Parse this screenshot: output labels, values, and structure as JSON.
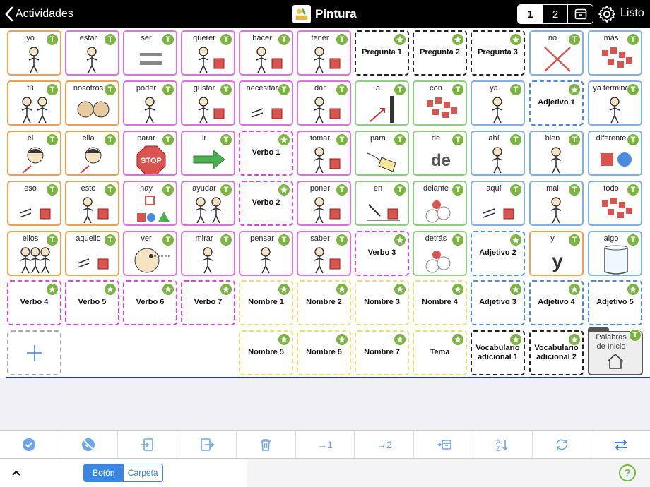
{
  "topbar": {
    "back_label": "Actividades",
    "title": "Pintura",
    "page_segments": [
      "1",
      "2"
    ],
    "done_label": "Listo"
  },
  "grid": [
    [
      {
        "t": "b",
        "label": "yo",
        "c": "orange",
        "pic": "person"
      },
      {
        "t": "b",
        "label": "estar",
        "c": "pink",
        "pic": "person"
      },
      {
        "t": "b",
        "label": "ser",
        "c": "pink",
        "pic": "equals"
      },
      {
        "t": "b",
        "label": "querer",
        "c": "pink",
        "pic": "person-square"
      },
      {
        "t": "b",
        "label": "hacer",
        "c": "pink",
        "pic": "person-square"
      },
      {
        "t": "b",
        "label": "tener",
        "c": "pink",
        "pic": "person-square"
      },
      {
        "t": "f",
        "label": "Pregunta 1",
        "c": "black"
      },
      {
        "t": "f",
        "label": "Pregunta 2",
        "c": "black"
      },
      {
        "t": "f",
        "label": "Pregunta 3",
        "c": "black"
      },
      {
        "t": "b",
        "label": "no",
        "c": "blue",
        "pic": "cross"
      },
      {
        "t": "b",
        "label": "más",
        "c": "blue",
        "pic": "squares"
      }
    ],
    [
      {
        "t": "b",
        "label": "tú",
        "c": "orange",
        "pic": "two-person"
      },
      {
        "t": "b",
        "label": "nosotros",
        "c": "orange",
        "pic": "faces"
      },
      {
        "t": "b",
        "label": "poder",
        "c": "pink",
        "pic": "person"
      },
      {
        "t": "b",
        "label": "gustar",
        "c": "pink",
        "pic": "person-square"
      },
      {
        "t": "b",
        "label": "necesitar",
        "c": "pink",
        "pic": "hand-square"
      },
      {
        "t": "b",
        "label": "dar",
        "c": "pink",
        "pic": "person-square"
      },
      {
        "t": "b",
        "label": "a",
        "c": "green",
        "pic": "arrow-bar"
      },
      {
        "t": "b",
        "label": "con",
        "c": "green",
        "pic": "squares"
      },
      {
        "t": "b",
        "label": "ya",
        "c": "blue",
        "pic": "person"
      },
      {
        "t": "f",
        "label": "Adjetivo 1",
        "c": "blue"
      },
      {
        "t": "b",
        "label": "ya terminó",
        "c": "blue",
        "pic": "person"
      }
    ],
    [
      {
        "t": "b",
        "label": "él",
        "c": "orange",
        "pic": "face"
      },
      {
        "t": "b",
        "label": "ella",
        "c": "orange",
        "pic": "face"
      },
      {
        "t": "b",
        "label": "parar",
        "c": "pink",
        "pic": "stop"
      },
      {
        "t": "b",
        "label": "ir",
        "c": "pink",
        "pic": "arrow-right"
      },
      {
        "t": "f",
        "label": "Verbo 1",
        "c": "pink"
      },
      {
        "t": "b",
        "label": "tomar",
        "c": "pink",
        "pic": "person-square"
      },
      {
        "t": "b",
        "label": "para",
        "c": "green",
        "pic": "tag"
      },
      {
        "t": "b",
        "label": "de",
        "c": "green",
        "pic": "big-de"
      },
      {
        "t": "b",
        "label": "ahí",
        "c": "blue",
        "pic": "person"
      },
      {
        "t": "b",
        "label": "bien",
        "c": "blue",
        "pic": "person"
      },
      {
        "t": "b",
        "label": "diferente",
        "c": "blue",
        "pic": "square-circle"
      }
    ],
    [
      {
        "t": "b",
        "label": "eso",
        "c": "orange",
        "pic": "hand-square"
      },
      {
        "t": "b",
        "label": "esto",
        "c": "orange",
        "pic": "person-square"
      },
      {
        "t": "b",
        "label": "hay",
        "c": "pink",
        "pic": "shapes"
      },
      {
        "t": "b",
        "label": "ayudar",
        "c": "pink",
        "pic": "two-person"
      },
      {
        "t": "f",
        "label": "Verbo 2",
        "c": "pink"
      },
      {
        "t": "b",
        "label": "poner",
        "c": "pink",
        "pic": "person-square"
      },
      {
        "t": "b",
        "label": "en",
        "c": "green",
        "pic": "arrow-square"
      },
      {
        "t": "b",
        "label": "delante",
        "c": "green",
        "pic": "balls"
      },
      {
        "t": "b",
        "label": "aquí",
        "c": "blue",
        "pic": "hand-square"
      },
      {
        "t": "b",
        "label": "mal",
        "c": "blue",
        "pic": "person"
      },
      {
        "t": "b",
        "label": "todo",
        "c": "blue",
        "pic": "squares"
      }
    ],
    [
      {
        "t": "b",
        "label": "ellos",
        "c": "orange",
        "pic": "group"
      },
      {
        "t": "b",
        "label": "aquello",
        "c": "orange",
        "pic": "hand-square"
      },
      {
        "t": "b",
        "label": "ver",
        "c": "pink",
        "pic": "eye-face"
      },
      {
        "t": "b",
        "label": "mirar",
        "c": "pink",
        "pic": "person"
      },
      {
        "t": "b",
        "label": "pensar",
        "c": "pink",
        "pic": "person"
      },
      {
        "t": "b",
        "label": "saber",
        "c": "pink",
        "pic": "person-square"
      },
      {
        "t": "f",
        "label": "Verbo 3",
        "c": "pink"
      },
      {
        "t": "b",
        "label": "detrás",
        "c": "green",
        "pic": "balls"
      },
      {
        "t": "f",
        "label": "Adjetivo 2",
        "c": "blue"
      },
      {
        "t": "b",
        "label": "y",
        "c": "orange",
        "pic": "big-y"
      },
      {
        "t": "b",
        "label": "algo",
        "c": "blue",
        "pic": "glass"
      }
    ],
    [
      {
        "t": "f",
        "label": "Verbo 4",
        "c": "pink"
      },
      {
        "t": "f",
        "label": "Verbo 5",
        "c": "pink"
      },
      {
        "t": "f",
        "label": "Verbo 6",
        "c": "pink"
      },
      {
        "t": "f",
        "label": "Verbo 7",
        "c": "pink"
      },
      {
        "t": "f",
        "label": "Nombre 1",
        "c": "yellow"
      },
      {
        "t": "f",
        "label": "Nombre 2",
        "c": "yellow"
      },
      {
        "t": "f",
        "label": "Nombre 3",
        "c": "yellow"
      },
      {
        "t": "f",
        "label": "Nombre 4",
        "c": "yellow"
      },
      {
        "t": "f",
        "label": "Adjetivo 3",
        "c": "blue"
      },
      {
        "t": "f",
        "label": "Adjetivo 4",
        "c": "blue"
      },
      {
        "t": "f",
        "label": "Adjetivo 5",
        "c": "blue"
      }
    ],
    [
      null,
      null,
      null,
      null,
      {
        "t": "f",
        "label": "Nombre 5",
        "c": "yellow"
      },
      {
        "t": "f",
        "label": "Nombre 6",
        "c": "yellow"
      },
      {
        "t": "f",
        "label": "Nombre 7",
        "c": "yellow"
      },
      {
        "t": "f",
        "label": "Tema",
        "c": "yellow"
      },
      {
        "t": "f",
        "label": "Vocabulario adicional 1",
        "c": "black"
      },
      {
        "t": "f",
        "label": "Vocabulario adicional 2",
        "c": "black"
      },
      null
    ]
  ],
  "home_folder": {
    "label": "Palabras de Inicio"
  },
  "toolbar": {
    "items": [
      "check-circle-icon",
      "unselect-icon",
      "import-icon",
      "export-icon",
      "trash-icon",
      "move-page-1",
      "move-page-2",
      "move-to-folder",
      "sort-az-icon",
      "refresh-icon",
      "swap-icon"
    ],
    "page1_label": "→1",
    "page2_label": "→2"
  },
  "bottom": {
    "button_label": "Botón",
    "folder_label": "Carpeta",
    "help_label": "?"
  },
  "colors": {
    "orange": "#f0a050",
    "pink": "#e070e0",
    "green": "#8ed081",
    "blue": "#7fb0e8",
    "badge": "#7cb342",
    "accent": "#3a86e0"
  }
}
